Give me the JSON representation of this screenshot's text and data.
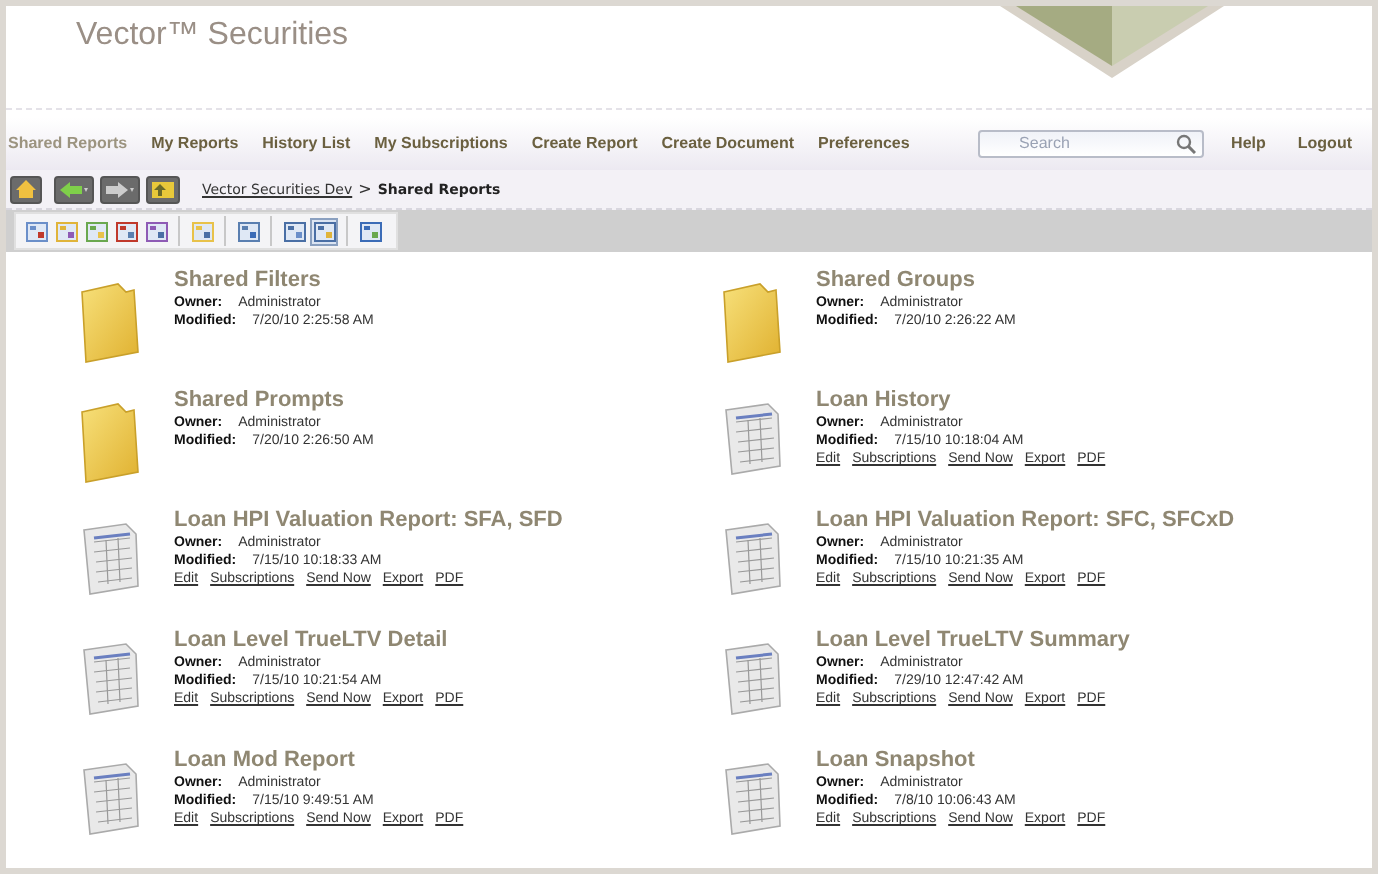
{
  "header": {
    "brand": "Vector™ Securities"
  },
  "nav": {
    "items": [
      {
        "label": "Shared Reports",
        "selected": true
      },
      {
        "label": "My Reports",
        "selected": false
      },
      {
        "label": "History List",
        "selected": false
      },
      {
        "label": "My Subscriptions",
        "selected": false
      },
      {
        "label": "Create Report",
        "selected": false
      },
      {
        "label": "Create Document",
        "selected": false
      },
      {
        "label": "Preferences",
        "selected": false
      }
    ],
    "search": {
      "placeholder": "Search"
    },
    "links": [
      "Help",
      "Logout"
    ]
  },
  "breadcrumb": {
    "link": "Vector Securities Dev",
    "separator": ">",
    "current": "Shared Reports"
  },
  "toolbar": {
    "groups": [
      [
        {
          "selected": false
        },
        {
          "selected": false
        },
        {
          "selected": false
        },
        {
          "selected": false
        },
        {
          "selected": false
        }
      ],
      [
        {
          "selected": false
        }
      ],
      [
        {
          "selected": false
        }
      ],
      [
        {
          "selected": false
        },
        {
          "selected": true
        }
      ],
      [
        {
          "selected": false
        }
      ]
    ]
  },
  "items": [
    {
      "kind": "folder",
      "title": "Shared Filters",
      "owner_label": "Owner:",
      "owner": "Administrator",
      "modified_label": "Modified:",
      "modified": "7/20/10 2:25:58 AM"
    },
    {
      "kind": "folder",
      "title": "Shared Groups",
      "owner_label": "Owner:",
      "owner": "Administrator",
      "modified_label": "Modified:",
      "modified": "7/20/10 2:26:22 AM"
    },
    {
      "kind": "folder",
      "title": "Shared Prompts",
      "owner_label": "Owner:",
      "owner": "Administrator",
      "modified_label": "Modified:",
      "modified": "7/20/10 2:26:50 AM"
    },
    {
      "kind": "report",
      "title": "Loan History",
      "owner_label": "Owner:",
      "owner": "Administrator",
      "modified_label": "Modified:",
      "modified": "7/15/10 10:18:04 AM",
      "actions": [
        "Edit",
        "Subscriptions",
        "Send Now",
        "Export",
        "PDF"
      ]
    },
    {
      "kind": "report",
      "title": "Loan HPI Valuation Report: SFA, SFD",
      "owner_label": "Owner:",
      "owner": "Administrator",
      "modified_label": "Modified:",
      "modified": "7/15/10 10:18:33 AM",
      "actions": [
        "Edit",
        "Subscriptions",
        "Send Now",
        "Export",
        "PDF"
      ]
    },
    {
      "kind": "report",
      "title": "Loan HPI Valuation Report: SFC, SFCxD",
      "owner_label": "Owner:",
      "owner": "Administrator",
      "modified_label": "Modified:",
      "modified": "7/15/10 10:21:35 AM",
      "actions": [
        "Edit",
        "Subscriptions",
        "Send Now",
        "Export",
        "PDF"
      ]
    },
    {
      "kind": "report",
      "title": "Loan Level TrueLTV Detail",
      "owner_label": "Owner:",
      "owner": "Administrator",
      "modified_label": "Modified:",
      "modified": "7/15/10 10:21:54 AM",
      "actions": [
        "Edit",
        "Subscriptions",
        "Send Now",
        "Export",
        "PDF"
      ]
    },
    {
      "kind": "report",
      "title": "Loan Level TrueLTV Summary",
      "owner_label": "Owner:",
      "owner": "Administrator",
      "modified_label": "Modified:",
      "modified": "7/29/10 12:47:42 AM",
      "actions": [
        "Edit",
        "Subscriptions",
        "Send Now",
        "Export",
        "PDF"
      ]
    },
    {
      "kind": "report",
      "title": "Loan Mod Report",
      "owner_label": "Owner:",
      "owner": "Administrator",
      "modified_label": "Modified:",
      "modified": "7/15/10 9:49:51 AM",
      "actions": [
        "Edit",
        "Subscriptions",
        "Send Now",
        "Export",
        "PDF"
      ]
    },
    {
      "kind": "report",
      "title": "Loan Snapshot",
      "owner_label": "Owner:",
      "owner": "Administrator",
      "modified_label": "Modified:",
      "modified": "7/8/10 10:06:43 AM",
      "actions": [
        "Edit",
        "Subscriptions",
        "Send Now",
        "Export",
        "PDF"
      ]
    }
  ]
}
